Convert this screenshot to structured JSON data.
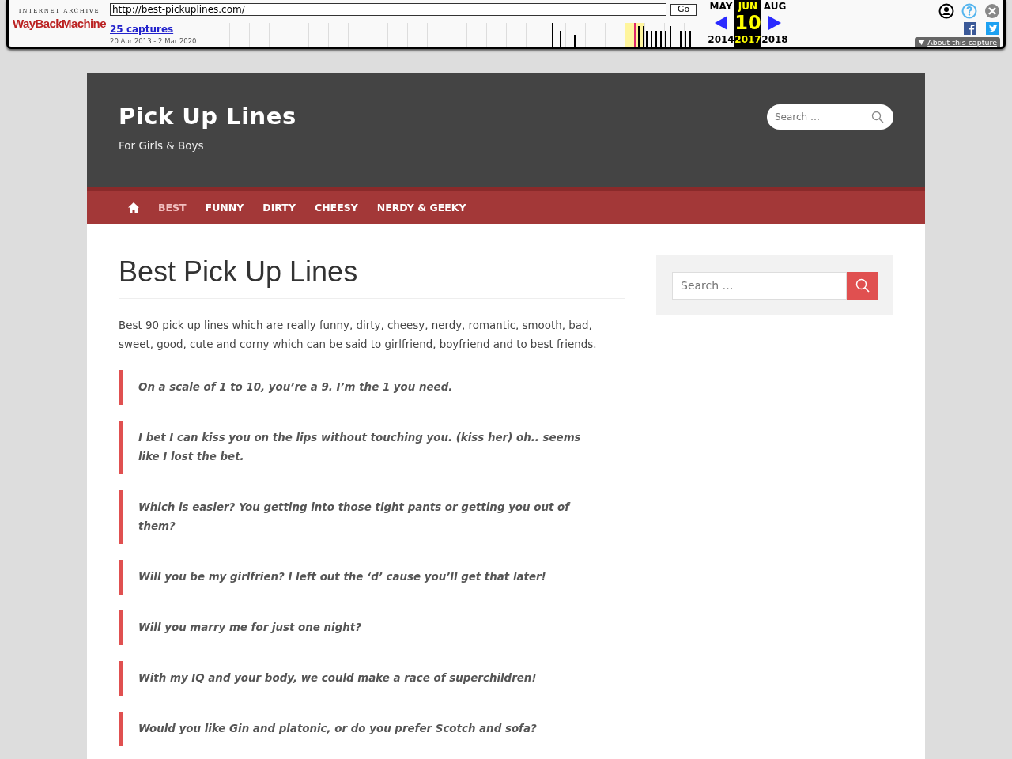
{
  "wayback": {
    "logo_top": "INTERNET ARCHIVE",
    "logo_main": "WayBackMachine",
    "url": "http://best-pickuplines.com/",
    "go": "Go",
    "captures": "25 captures",
    "range": "20 Apr 2013 - 2 Mar 2020",
    "months": [
      {
        "month": "MAY",
        "year": "2014",
        "selected": false
      },
      {
        "month": "JUN",
        "day": "10",
        "year": "2017",
        "selected": true
      },
      {
        "month": "AUG",
        "year": "2018",
        "selected": false
      }
    ],
    "about": "About this capture"
  },
  "site": {
    "title": "Pick Up Lines",
    "tagline": "For Girls & Boys",
    "search_placeholder": "Search …"
  },
  "nav": [
    {
      "kind": "home"
    },
    {
      "kind": "text",
      "label": "BEST",
      "selected": true
    },
    {
      "kind": "text",
      "label": "FUNNY",
      "selected": false
    },
    {
      "kind": "text",
      "label": "DIRTY",
      "selected": false
    },
    {
      "kind": "text",
      "label": "CHEESY",
      "selected": false
    },
    {
      "kind": "text",
      "label": "NERDY & GEEKY",
      "selected": false
    }
  ],
  "article": {
    "title": "Best Pick Up Lines",
    "intro": "Best 90 pick up lines which are really funny, dirty, cheesy, nerdy, romantic, smooth, bad, sweet, good, cute and corny which can be said to girlfriend, boyfriend and to best friends.",
    "quotes": [
      "On a scale of 1 to 10, you’re a 9. I’m the 1 you need.",
      "I bet I can kiss you on the lips without touching you. (kiss her) oh.. seems like I lost the bet.",
      "Which is easier? You getting into those tight pants or getting you out of them?",
      "Will you be my girlfrien? I left out the ‘d’ cause you’ll get that later!",
      "Will you marry me for just one night?",
      "With my IQ and your body, we could make a race of superchildren!",
      "Would you like Gin and platonic, or do you prefer Scotch and sofa?"
    ]
  },
  "sidebar": {
    "search_placeholder": "Search …"
  }
}
